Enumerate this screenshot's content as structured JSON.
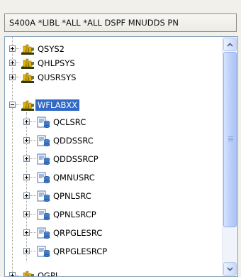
{
  "filter": {
    "text": "S400A  *LIBL  *ALL  *ALL  DSPF  MNUDDS  PN"
  },
  "tree": {
    "items": [
      {
        "label": "QSYS2"
      },
      {
        "label": "QHLPSYS"
      },
      {
        "label": "QUSRSYS"
      },
      {
        "label": "WFLABXX"
      },
      {
        "label": "QCLSRC"
      },
      {
        "label": "QDDSSRC"
      },
      {
        "label": "QDDSSRCP"
      },
      {
        "label": "QMNUSRC"
      },
      {
        "label": "QPNLSRC"
      },
      {
        "label": "QPNLSRCP"
      },
      {
        "label": "QRPGLESRC"
      },
      {
        "label": "QRPGLESRCP"
      },
      {
        "label": "QGPL"
      }
    ]
  },
  "colors": {
    "selection": "#316ac5",
    "library_icon": "#d9a600",
    "source_file_icon": "#3d78c9"
  }
}
